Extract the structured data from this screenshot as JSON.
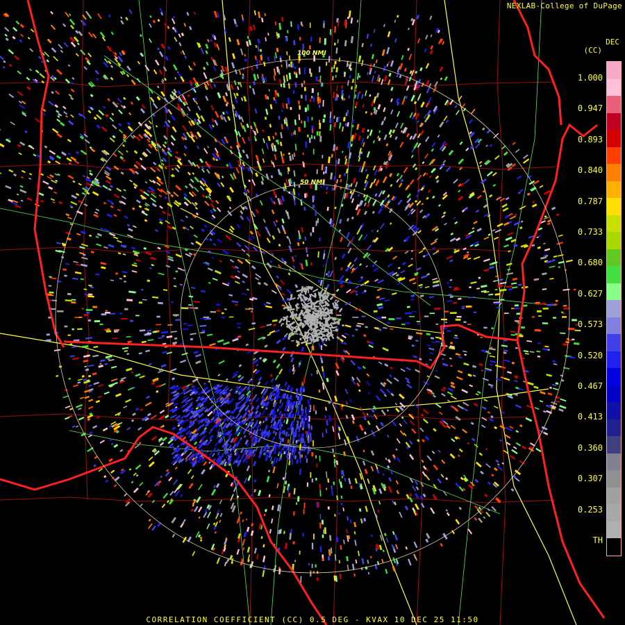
{
  "header": {
    "credit": "NEXLAB-College of DuPage"
  },
  "legend": {
    "unit_line1": "DEC",
    "unit_line2": "(CC)",
    "ticks": [
      "1.000",
      "0.947",
      "0.893",
      "0.840",
      "0.787",
      "0.733",
      "0.680",
      "0.627",
      "0.573",
      "0.520",
      "0.467",
      "0.413",
      "0.360",
      "0.307",
      "0.253",
      "TH"
    ],
    "colors": [
      "#f8a8c8",
      "#ffc0d8",
      "#e8607a",
      "#c00020",
      "#d40000",
      "#ff4000",
      "#ff8000",
      "#ffb000",
      "#ffe000",
      "#c8e000",
      "#a8d800",
      "#60c820",
      "#40e040",
      "#88ff88",
      "#a0a0d8",
      "#8080e0",
      "#4040e8",
      "#2020f0",
      "#0000e0",
      "#0000c8",
      "#1010a8",
      "#202090",
      "#404080",
      "#808090",
      "#909090",
      "#a0a0a0",
      "#a8a8a8",
      "#b0b0b0",
      "#000000"
    ]
  },
  "rings": [
    {
      "label": "100 NMI"
    },
    {
      "label": "50 NMI"
    }
  ],
  "footer": {
    "caption": "CORRELATION COEFFICIENT (CC) 0.5 DEG - KVAX 10 DEC 25 11:50"
  },
  "map_colors": {
    "state_border": "#ff2020",
    "county_border": "#9a1010",
    "highway": "#ffff44",
    "road": "#60e060",
    "ring": "#e8d0a0"
  }
}
